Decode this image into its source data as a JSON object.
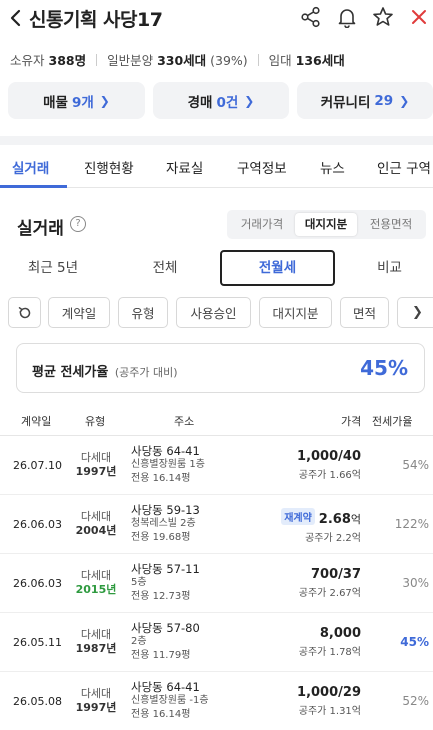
{
  "header": {
    "title": "신통기획 사당17"
  },
  "stats": {
    "owner_label": "소유자",
    "owner_value": "388명",
    "general_label": "일반분양",
    "general_value": "330세대",
    "general_pct": "(39%)",
    "rental_label": "임대",
    "rental_value": "136세대"
  },
  "quick_buttons": [
    {
      "label": "매물",
      "count": "9개"
    },
    {
      "label": "경매",
      "count": "0건"
    },
    {
      "label": "커뮤니티",
      "count": "29"
    }
  ],
  "tabs": [
    "실거래",
    "진행현황",
    "자료실",
    "구역정보",
    "뉴스",
    "인근 구역"
  ],
  "section": {
    "title": "실거래",
    "help": "?",
    "segments": [
      "거래가격",
      "대지지분",
      "전용면적"
    ]
  },
  "period_tabs": [
    "최근 5년",
    "전체",
    "전월세",
    "비교"
  ],
  "filters": [
    "계약일",
    "유형",
    "사용승인",
    "대지지분",
    "면적"
  ],
  "average": {
    "label": "평균 전세가율",
    "sub": "(공주가 대비)",
    "value": "45%"
  },
  "table": {
    "headers": [
      "계약일",
      "유형",
      "주소",
      "가격",
      "전세가율"
    ],
    "rows": [
      {
        "date": "26.07.10",
        "type": "다세대",
        "year": "1997년",
        "addr1": "사당동 64-41",
        "addr2": "신흥별장원룸 1층",
        "addr3": "전용 16.14평",
        "badge": "",
        "price": "1,000/40",
        "unit": "",
        "pub": "공주가 1.66억",
        "ratio": "54%"
      },
      {
        "date": "26.06.03",
        "type": "다세대",
        "year": "2004년",
        "addr1": "사당동 59-13",
        "addr2": "청복레스빌 2층",
        "addr3": "전용 19.68평",
        "badge": "재계약",
        "price": "2.68",
        "unit": "억",
        "pub": "공주가 2.2억",
        "ratio": "122%"
      },
      {
        "date": "26.06.03",
        "type": "다세대",
        "year": "2015년",
        "addr1": "사당동 57-11",
        "addr2": "5층",
        "addr3": "전용 12.73평",
        "badge": "",
        "price": "700/37",
        "unit": "",
        "pub": "공주가 2.67억",
        "ratio": "30%"
      },
      {
        "date": "26.05.11",
        "type": "다세대",
        "year": "1987년",
        "addr1": "사당동 57-80",
        "addr2": "2층",
        "addr3": "전용 11.79평",
        "badge": "",
        "price": "8,000",
        "unit": "",
        "pub": "공주가 1.78억",
        "ratio": "45%"
      },
      {
        "date": "26.05.08",
        "type": "다세대",
        "year": "1997년",
        "addr1": "사당동 64-41",
        "addr2": "신흥별장원룸 -1층",
        "addr3": "전용 16.14평",
        "badge": "",
        "price": "1,000/29",
        "unit": "",
        "pub": "공주가 1.31억",
        "ratio": "52%"
      }
    ]
  },
  "colors": {
    "accent": "#3f6ad8",
    "new_year": "#2e9a3f",
    "close": "#e03c3c"
  }
}
